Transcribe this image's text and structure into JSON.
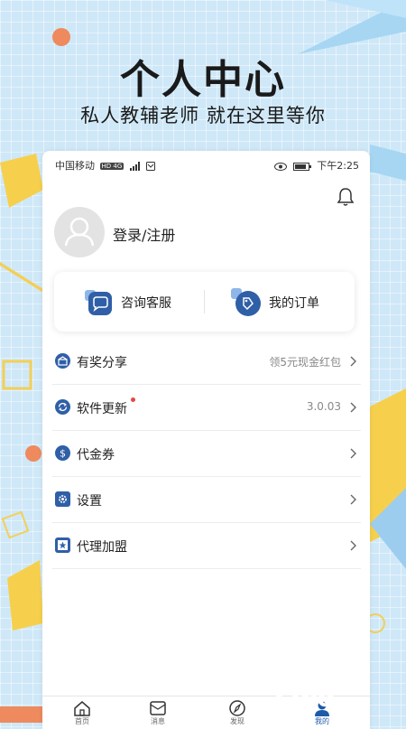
{
  "hero": {
    "title": "个人中心",
    "subtitle": "私人教辅老师 就在这里等你"
  },
  "status_bar": {
    "carrier": "中国移动",
    "network": "HD 4G",
    "time": "下午2:25"
  },
  "profile": {
    "login_label": "登录/注册"
  },
  "quick_actions": [
    {
      "label": "咨询客服",
      "icon": "chat-bubble-icon"
    },
    {
      "label": "我的订单",
      "icon": "order-icon"
    }
  ],
  "menu": [
    {
      "label": "有奖分享",
      "value": "领5元现金红包",
      "icon": "gift-icon",
      "dot": false
    },
    {
      "label": "软件更新",
      "value": "3.0.03",
      "icon": "refresh-icon",
      "dot": true
    },
    {
      "label": "代金券",
      "value": "",
      "icon": "coupon-icon",
      "dot": false
    },
    {
      "label": "设置",
      "value": "",
      "icon": "gear-icon",
      "dot": false
    },
    {
      "label": "代理加盟",
      "value": "",
      "icon": "star-badge-icon",
      "dot": false
    }
  ],
  "tabbar": [
    {
      "label": "首页",
      "icon": "home-icon"
    },
    {
      "label": "消息",
      "icon": "message-icon"
    },
    {
      "label": "发现",
      "icon": "compass-icon"
    },
    {
      "label": "我的",
      "icon": "user-icon",
      "active": true
    }
  ],
  "watermark": {
    "number": "2265",
    "site": "手游网"
  },
  "colors": {
    "accent": "#1e5aa8",
    "icon_blue": "#2f5fa7",
    "background": "#cfe8f8",
    "red_dot": "#e84545"
  }
}
